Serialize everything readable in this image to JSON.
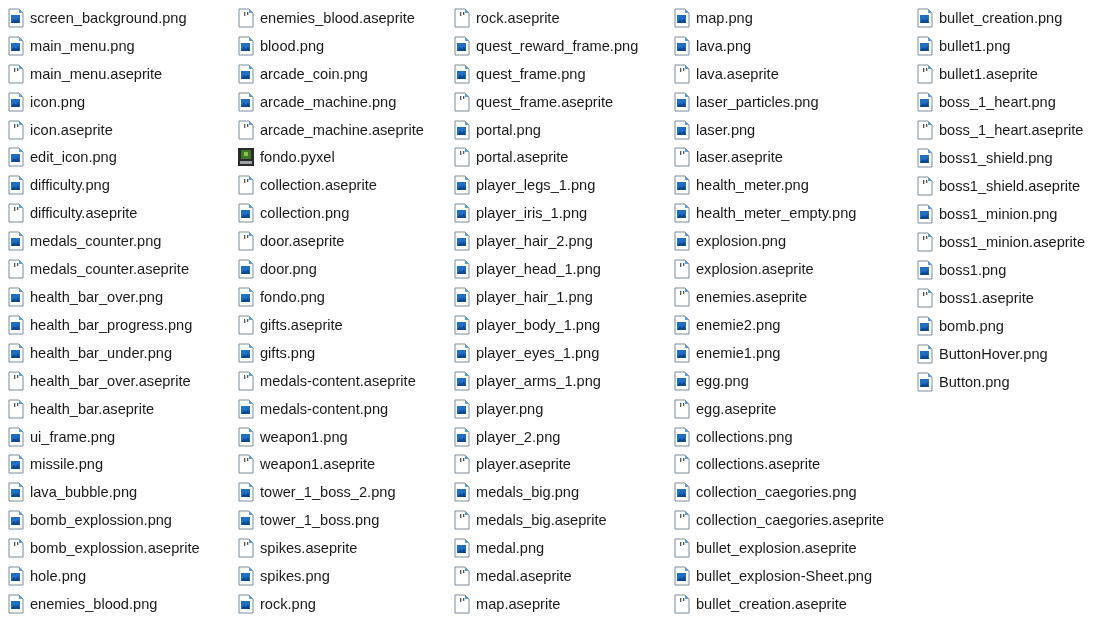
{
  "columns": [
    [
      {
        "name": "screen_background.png",
        "kind": "png"
      },
      {
        "name": "main_menu.png",
        "kind": "png"
      },
      {
        "name": "main_menu.aseprite",
        "kind": "aseprite"
      },
      {
        "name": "icon.png",
        "kind": "png"
      },
      {
        "name": "icon.aseprite",
        "kind": "aseprite"
      },
      {
        "name": "edit_icon.png",
        "kind": "png"
      },
      {
        "name": "difficulty.png",
        "kind": "png"
      },
      {
        "name": "difficulty.aseprite",
        "kind": "aseprite"
      },
      {
        "name": "medals_counter.png",
        "kind": "png"
      },
      {
        "name": "medals_counter.aseprite",
        "kind": "aseprite"
      },
      {
        "name": "health_bar_over.png",
        "kind": "png"
      },
      {
        "name": "health_bar_progress.png",
        "kind": "png"
      },
      {
        "name": "health_bar_under.png",
        "kind": "png"
      },
      {
        "name": "health_bar_over.aseprite",
        "kind": "aseprite"
      },
      {
        "name": "health_bar.aseprite",
        "kind": "aseprite"
      },
      {
        "name": "ui_frame.png",
        "kind": "png"
      },
      {
        "name": "missile.png",
        "kind": "png"
      },
      {
        "name": "lava_bubble.png",
        "kind": "png"
      },
      {
        "name": "bomb_explossion.png",
        "kind": "png"
      },
      {
        "name": "bomb_explossion.aseprite",
        "kind": "aseprite"
      },
      {
        "name": "hole.png",
        "kind": "png"
      },
      {
        "name": "enemies_blood.png",
        "kind": "png"
      }
    ],
    [
      {
        "name": "enemies_blood.aseprite",
        "kind": "aseprite"
      },
      {
        "name": "blood.png",
        "kind": "png"
      },
      {
        "name": "arcade_coin.png",
        "kind": "png"
      },
      {
        "name": "arcade_machine.png",
        "kind": "png"
      },
      {
        "name": "arcade_machine.aseprite",
        "kind": "aseprite"
      },
      {
        "name": "fondo.pyxel",
        "kind": "pyxel"
      },
      {
        "name": "collection.aseprite",
        "kind": "aseprite"
      },
      {
        "name": "collection.png",
        "kind": "png"
      },
      {
        "name": "door.aseprite",
        "kind": "aseprite"
      },
      {
        "name": "door.png",
        "kind": "png"
      },
      {
        "name": "fondo.png",
        "kind": "png"
      },
      {
        "name": "gifts.aseprite",
        "kind": "aseprite"
      },
      {
        "name": "gifts.png",
        "kind": "png"
      },
      {
        "name": "medals-content.aseprite",
        "kind": "aseprite"
      },
      {
        "name": "medals-content.png",
        "kind": "png"
      },
      {
        "name": "weapon1.png",
        "kind": "png"
      },
      {
        "name": "weapon1.aseprite",
        "kind": "aseprite"
      },
      {
        "name": "tower_1_boss_2.png",
        "kind": "png"
      },
      {
        "name": "tower_1_boss.png",
        "kind": "png"
      },
      {
        "name": "spikes.aseprite",
        "kind": "aseprite"
      },
      {
        "name": "spikes.png",
        "kind": "png"
      },
      {
        "name": "rock.png",
        "kind": "png"
      }
    ],
    [
      {
        "name": "rock.aseprite",
        "kind": "aseprite"
      },
      {
        "name": "quest_reward_frame.png",
        "kind": "png"
      },
      {
        "name": "quest_frame.png",
        "kind": "png"
      },
      {
        "name": "quest_frame.aseprite",
        "kind": "aseprite"
      },
      {
        "name": "portal.png",
        "kind": "png"
      },
      {
        "name": "portal.aseprite",
        "kind": "aseprite"
      },
      {
        "name": "player_legs_1.png",
        "kind": "png"
      },
      {
        "name": "player_iris_1.png",
        "kind": "png"
      },
      {
        "name": "player_hair_2.png",
        "kind": "png"
      },
      {
        "name": "player_head_1.png",
        "kind": "png"
      },
      {
        "name": "player_hair_1.png",
        "kind": "png"
      },
      {
        "name": "player_body_1.png",
        "kind": "png"
      },
      {
        "name": "player_eyes_1.png",
        "kind": "png"
      },
      {
        "name": "player_arms_1.png",
        "kind": "png"
      },
      {
        "name": "player.png",
        "kind": "png"
      },
      {
        "name": "player_2.png",
        "kind": "png"
      },
      {
        "name": "player.aseprite",
        "kind": "aseprite"
      },
      {
        "name": "medals_big.png",
        "kind": "png"
      },
      {
        "name": "medals_big.aseprite",
        "kind": "aseprite"
      },
      {
        "name": "medal.png",
        "kind": "png"
      },
      {
        "name": "medal.aseprite",
        "kind": "aseprite"
      },
      {
        "name": "map.aseprite",
        "kind": "aseprite"
      }
    ],
    [
      {
        "name": "map.png",
        "kind": "png"
      },
      {
        "name": "lava.png",
        "kind": "png"
      },
      {
        "name": "lava.aseprite",
        "kind": "aseprite"
      },
      {
        "name": "laser_particles.png",
        "kind": "png"
      },
      {
        "name": "laser.png",
        "kind": "png"
      },
      {
        "name": "laser.aseprite",
        "kind": "aseprite"
      },
      {
        "name": "health_meter.png",
        "kind": "png"
      },
      {
        "name": "health_meter_empty.png",
        "kind": "png"
      },
      {
        "name": "explosion.png",
        "kind": "png"
      },
      {
        "name": "explosion.aseprite",
        "kind": "aseprite"
      },
      {
        "name": "enemies.aseprite",
        "kind": "aseprite"
      },
      {
        "name": "enemie2.png",
        "kind": "png"
      },
      {
        "name": "enemie1.png",
        "kind": "png"
      },
      {
        "name": "egg.png",
        "kind": "png"
      },
      {
        "name": "egg.aseprite",
        "kind": "aseprite"
      },
      {
        "name": "collections.png",
        "kind": "png"
      },
      {
        "name": "collections.aseprite",
        "kind": "aseprite"
      },
      {
        "name": "collection_caegories.png",
        "kind": "png"
      },
      {
        "name": "collection_caegories.aseprite",
        "kind": "aseprite"
      },
      {
        "name": "bullet_explosion.aseprite",
        "kind": "aseprite"
      },
      {
        "name": "bullet_explosion-Sheet.png",
        "kind": "png"
      },
      {
        "name": "bullet_creation.aseprite",
        "kind": "aseprite"
      }
    ],
    [
      {
        "name": "bullet_creation.png",
        "kind": "png"
      },
      {
        "name": "bullet1.png",
        "kind": "png"
      },
      {
        "name": "bullet1.aseprite",
        "kind": "aseprite"
      },
      {
        "name": "boss_1_heart.png",
        "kind": "png"
      },
      {
        "name": "boss_1_heart.aseprite",
        "kind": "aseprite"
      },
      {
        "name": "boss1_shield.png",
        "kind": "png"
      },
      {
        "name": "boss1_shield.aseprite",
        "kind": "aseprite"
      },
      {
        "name": "boss1_minion.png",
        "kind": "png"
      },
      {
        "name": "boss1_minion.aseprite",
        "kind": "aseprite"
      },
      {
        "name": "boss1.png",
        "kind": "png"
      },
      {
        "name": "boss1.aseprite",
        "kind": "aseprite"
      },
      {
        "name": "bomb.png",
        "kind": "png"
      },
      {
        "name": "ButtonHover.png",
        "kind": "png"
      },
      {
        "name": "Button.png",
        "kind": "png"
      }
    ]
  ]
}
